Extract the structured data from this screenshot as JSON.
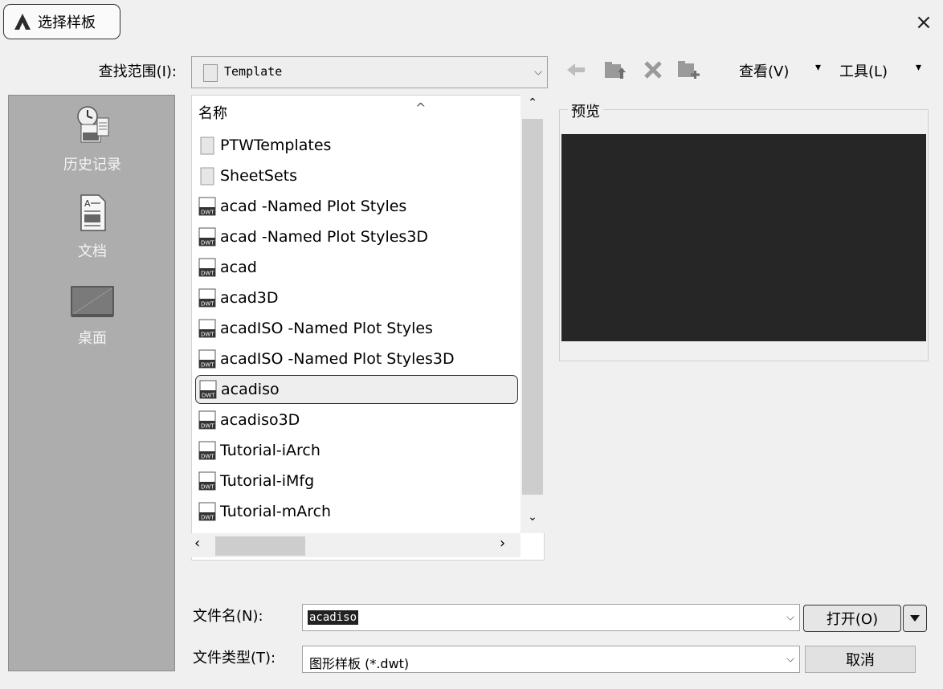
{
  "window": {
    "title": "选择样板",
    "close_glyph": "×"
  },
  "toolbar": {
    "look_in_label": "查找范围(I):",
    "look_in_value": "Template",
    "view_label": "查看(V)",
    "tools_label": "工具(L)",
    "menu_arrow": "▾"
  },
  "places": {
    "items": [
      {
        "label": "历史记录",
        "icon": "history-icon"
      },
      {
        "label": "文档",
        "icon": "document-icon"
      },
      {
        "label": "桌面",
        "icon": "desktop-icon"
      }
    ]
  },
  "file_list": {
    "column_name": "名称",
    "selected": "acadiso",
    "items": [
      {
        "name": "PTWTemplates",
        "type": "folder"
      },
      {
        "name": "SheetSets",
        "type": "folder"
      },
      {
        "name": "acad -Named Plot Styles",
        "type": "dwt"
      },
      {
        "name": "acad -Named Plot Styles3D",
        "type": "dwt"
      },
      {
        "name": "acad",
        "type": "dwt"
      },
      {
        "name": "acad3D",
        "type": "dwt"
      },
      {
        "name": "acadISO -Named Plot Styles",
        "type": "dwt"
      },
      {
        "name": "acadISO -Named Plot Styles3D",
        "type": "dwt"
      },
      {
        "name": "acadiso",
        "type": "dwt"
      },
      {
        "name": "acadiso3D",
        "type": "dwt"
      },
      {
        "name": "Tutorial-iArch",
        "type": "dwt"
      },
      {
        "name": "Tutorial-iMfg",
        "type": "dwt"
      },
      {
        "name": "Tutorial-mArch",
        "type": "dwt"
      }
    ]
  },
  "preview": {
    "label": "预览"
  },
  "bottom": {
    "filename_label": "文件名(N):",
    "filename_value": "acadiso",
    "filetype_label": "文件类型(T):",
    "filetype_value": "图形样板 (*.dwt)",
    "open_label": "打开(O)",
    "cancel_label": "取消"
  },
  "colors": {
    "places_bg": "#adadad",
    "preview_bg": "#262626",
    "dialog_bg": "#f0f0f0"
  }
}
